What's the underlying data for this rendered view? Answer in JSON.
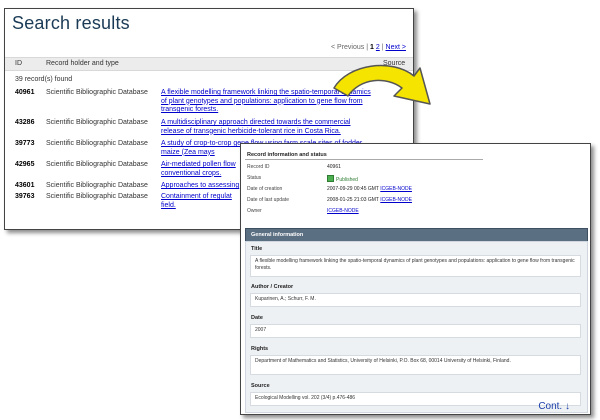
{
  "search": {
    "title": "Search results",
    "pager": {
      "previous": "< Previous",
      "sep1": "|",
      "page1": "1",
      "page2": "2",
      "sep2": "|",
      "next": "Next >"
    },
    "columns": {
      "id": "ID",
      "holder": "Record holder and type",
      "source": "Source"
    },
    "count": "39 record(s) found",
    "rows": [
      {
        "id": "40961",
        "type": "Scientific Bibliographic Database",
        "link": "A flexible modelling framework linking the spatio-temporal dynamics of plant genotypes and populations: application to gene flow from transgenic forests."
      },
      {
        "id": "43286",
        "type": "Scientific Bibliographic Database",
        "link": "A multidisciplinary approach directed towards the commercial release of transgenic herbicide-tolerant rice in Costa Rica."
      },
      {
        "id": "39773",
        "type": "Scientific Bibliographic Database",
        "link": "A study of crop-to-crop gene flow using farm scale sites of fodder maize (Zea mays"
      },
      {
        "id": "42965",
        "type": "Scientific Bibliographic Database",
        "link": "Air-mediated pollen flow conventional crops."
      },
      {
        "id": "43601",
        "type": "Scientific Bibliographic Database",
        "link": "Approaches to assessing"
      },
      {
        "id": "39763",
        "type": "Scientific Bibliographic Database",
        "link": "Containment of regulat field."
      }
    ]
  },
  "record": {
    "heading": "Record information and status",
    "fields": [
      {
        "label": "Record ID",
        "value": "40961"
      },
      {
        "label": "Status",
        "value": "Published"
      },
      {
        "label": "Date of creation",
        "value": "2007-09-29 00:45 GMT",
        "link": "ICGEB-NODE"
      },
      {
        "label": "Date of last update",
        "value": "2008-01-25 21:03 GMT",
        "link": "ICGEB-NODE"
      },
      {
        "label": "Owner",
        "value": "",
        "link": "ICGEB-NODE"
      }
    ],
    "status_color": "#2e7d32"
  },
  "general": {
    "heading": "General information",
    "title_label": "Title",
    "title_value": "A flexible modelling framework linking the spatio-temporal dynamics of plant genotypes and populations: application to gene flow from transgenic forests.",
    "author_label": "Author / Creator",
    "author_value": "Kuparinen, A.; Schurr, F. M.",
    "date_label": "Date",
    "date_value": "2007",
    "rights_label": "Rights",
    "rights_value": "Department of Mathematics and Statistics, University of Helsinki, P.O. Box 68, 00014 University of Helsinki, Finland.",
    "source_label": "Source",
    "source_value": "Ecological Modelling vol. 202 (3/4) p.476-486",
    "cont": "Cont. ↓"
  },
  "colors": {
    "arrow_fill": "#f5e400",
    "arrow_stroke": "#555555",
    "bar": "#5b6f82",
    "link": "#0000cc"
  }
}
